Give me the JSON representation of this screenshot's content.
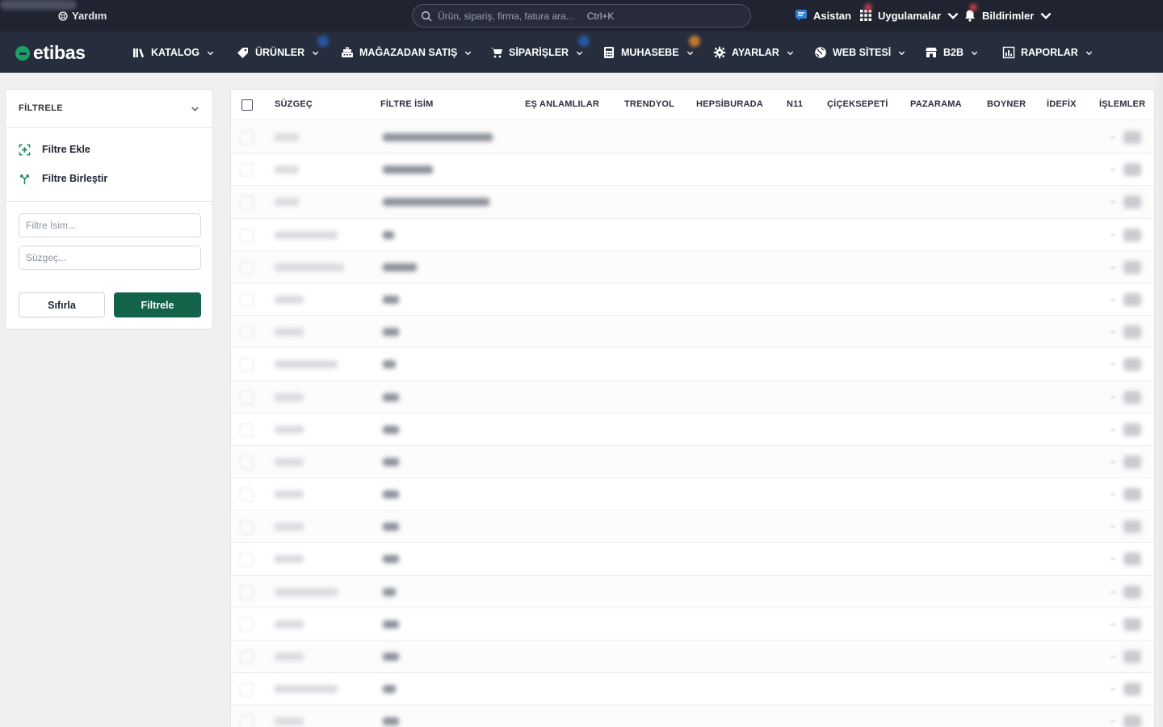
{
  "topbar": {
    "brand": "Etibas",
    "help": "Yardım",
    "search_placeholder": "Ürün, sipariş, firma, fatura ara...",
    "search_shortcut": "Ctrl+K",
    "assistant": "Asistan",
    "apps": "Uygulamalar",
    "notifications": "Bildirimler"
  },
  "logo": "etibas",
  "nav": [
    {
      "label": "KATALOG",
      "icon": "books-icon"
    },
    {
      "label": "ÜRÜNLER",
      "icon": "tag-icon"
    },
    {
      "label": "MAĞAZADAN SATIŞ",
      "icon": "cash-register-icon"
    },
    {
      "label": "SİPARİŞLER",
      "icon": "cart-icon"
    },
    {
      "label": "MUHASEBE",
      "icon": "calculator-icon"
    },
    {
      "label": "AYARLAR",
      "icon": "gear-icon"
    },
    {
      "label": "WEB SİTESİ",
      "icon": "globe-icon"
    },
    {
      "label": "B2B",
      "icon": "store-icon"
    },
    {
      "label": "RAPORLAR",
      "icon": "report-icon"
    }
  ],
  "filter_panel": {
    "title": "FİLTRELE",
    "add_filter": "Filtre Ekle",
    "merge_filter": "Filtre Birleştir",
    "name_placeholder": "Filtre İsim...",
    "selector_placeholder": "Süzgeç...",
    "reset": "Sıfırla",
    "apply": "Filtrele"
  },
  "table": {
    "columns": [
      "SÜZGEÇ",
      "FİLTRE İSİM",
      "EŞ ANLAMLILAR",
      "TRENDYOL",
      "HEPSİBURADA",
      "N11",
      "ÇİÇEKSEPETİ",
      "PAZARAMA",
      "BOYNER",
      "İDEFİX",
      "İŞLEMLER"
    ],
    "row_count": 19
  },
  "colors": {
    "topbar_bg": "#1f2430",
    "navbar_bg": "#262e3e",
    "accent": "#13624a",
    "logo_green": "#1aa167"
  }
}
